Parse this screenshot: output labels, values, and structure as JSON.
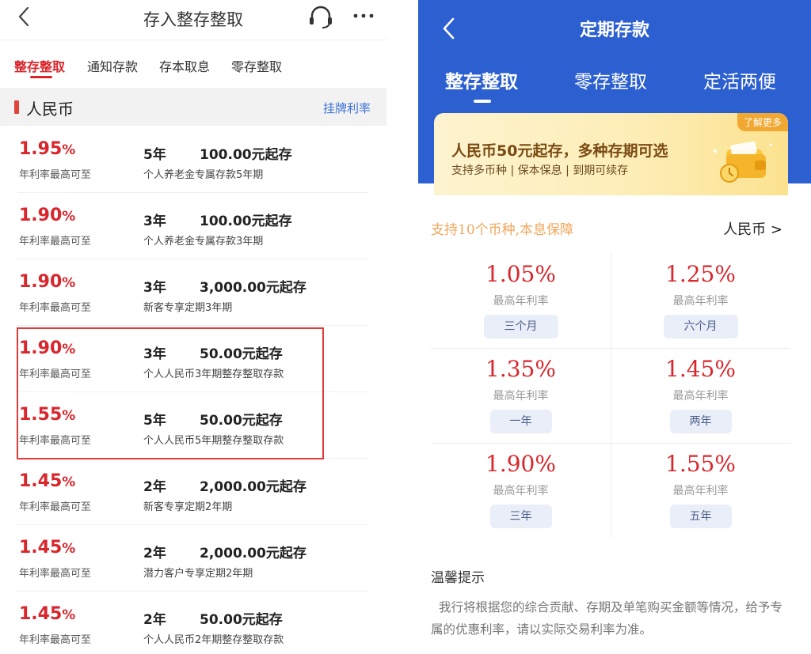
{
  "left": {
    "header": {
      "title": "存入整存整取"
    },
    "tabs": [
      {
        "label": "整存整取",
        "active": true
      },
      {
        "label": "通知存款",
        "active": false
      },
      {
        "label": "存本取息",
        "active": false
      },
      {
        "label": "零存整取",
        "active": false
      }
    ],
    "section": {
      "title": "人民币",
      "link": "挂牌利率"
    },
    "rate_label": "年利率最高可至",
    "products": [
      {
        "rate": "1.95",
        "term": "5年",
        "min": "100.00元起存",
        "desc": "个人养老金专属存款5年期"
      },
      {
        "rate": "1.90",
        "term": "3年",
        "min": "100.00元起存",
        "desc": "个人养老金专属存款3年期"
      },
      {
        "rate": "1.90",
        "term": "3年",
        "min": "3,000.00元起存",
        "desc": "新客专享定期3年期"
      },
      {
        "rate": "1.90",
        "term": "3年",
        "min": "50.00元起存",
        "desc": "个人人民币3年期整存整取存款"
      },
      {
        "rate": "1.55",
        "term": "5年",
        "min": "50.00元起存",
        "desc": "个人人民币5年期整存整取存款"
      },
      {
        "rate": "1.45",
        "term": "2年",
        "min": "2,000.00元起存",
        "desc": "新客专享定期2年期"
      },
      {
        "rate": "1.45",
        "term": "2年",
        "min": "2,000.00元起存",
        "desc": "潜力客户专享定期2年期"
      },
      {
        "rate": "1.45",
        "term": "2年",
        "min": "50.00元起存",
        "desc": "个人人民币2年期整存整取存款"
      }
    ],
    "percent_sign": "%"
  },
  "right": {
    "header": {
      "title": "定期存款"
    },
    "tabs": [
      {
        "label": "整存整取",
        "active": true
      },
      {
        "label": "零存整取",
        "active": false
      },
      {
        "label": "定活两便",
        "active": false
      }
    ],
    "banner": {
      "title": "人民币50元起存，多种存期可选",
      "subtitle": "支持多币种 | 保本保息 | 到期可续存",
      "tag": "了解更多"
    },
    "support_text": "支持10个币种,本息保障",
    "currency": "人民币 >",
    "rate_label": "最高年利率",
    "terms": [
      {
        "rate": "1.05%",
        "term": "三个月"
      },
      {
        "rate": "1.25%",
        "term": "六个月"
      },
      {
        "rate": "1.35%",
        "term": "一年"
      },
      {
        "rate": "1.45%",
        "term": "两年"
      },
      {
        "rate": "1.90%",
        "term": "三年"
      },
      {
        "rate": "1.55%",
        "term": "五年"
      }
    ],
    "tips": {
      "title": "温馨提示",
      "text": "我行将根据您的综合贡献、存期及单笔购买金额等情况，给予专属的优惠利率，请以实际交易利率为准。"
    }
  },
  "colors": {
    "rate_red": "#d9262c",
    "header_blue": "#2c5fd0",
    "link_blue": "#3b72d9",
    "support_orange": "#f0a65a"
  }
}
